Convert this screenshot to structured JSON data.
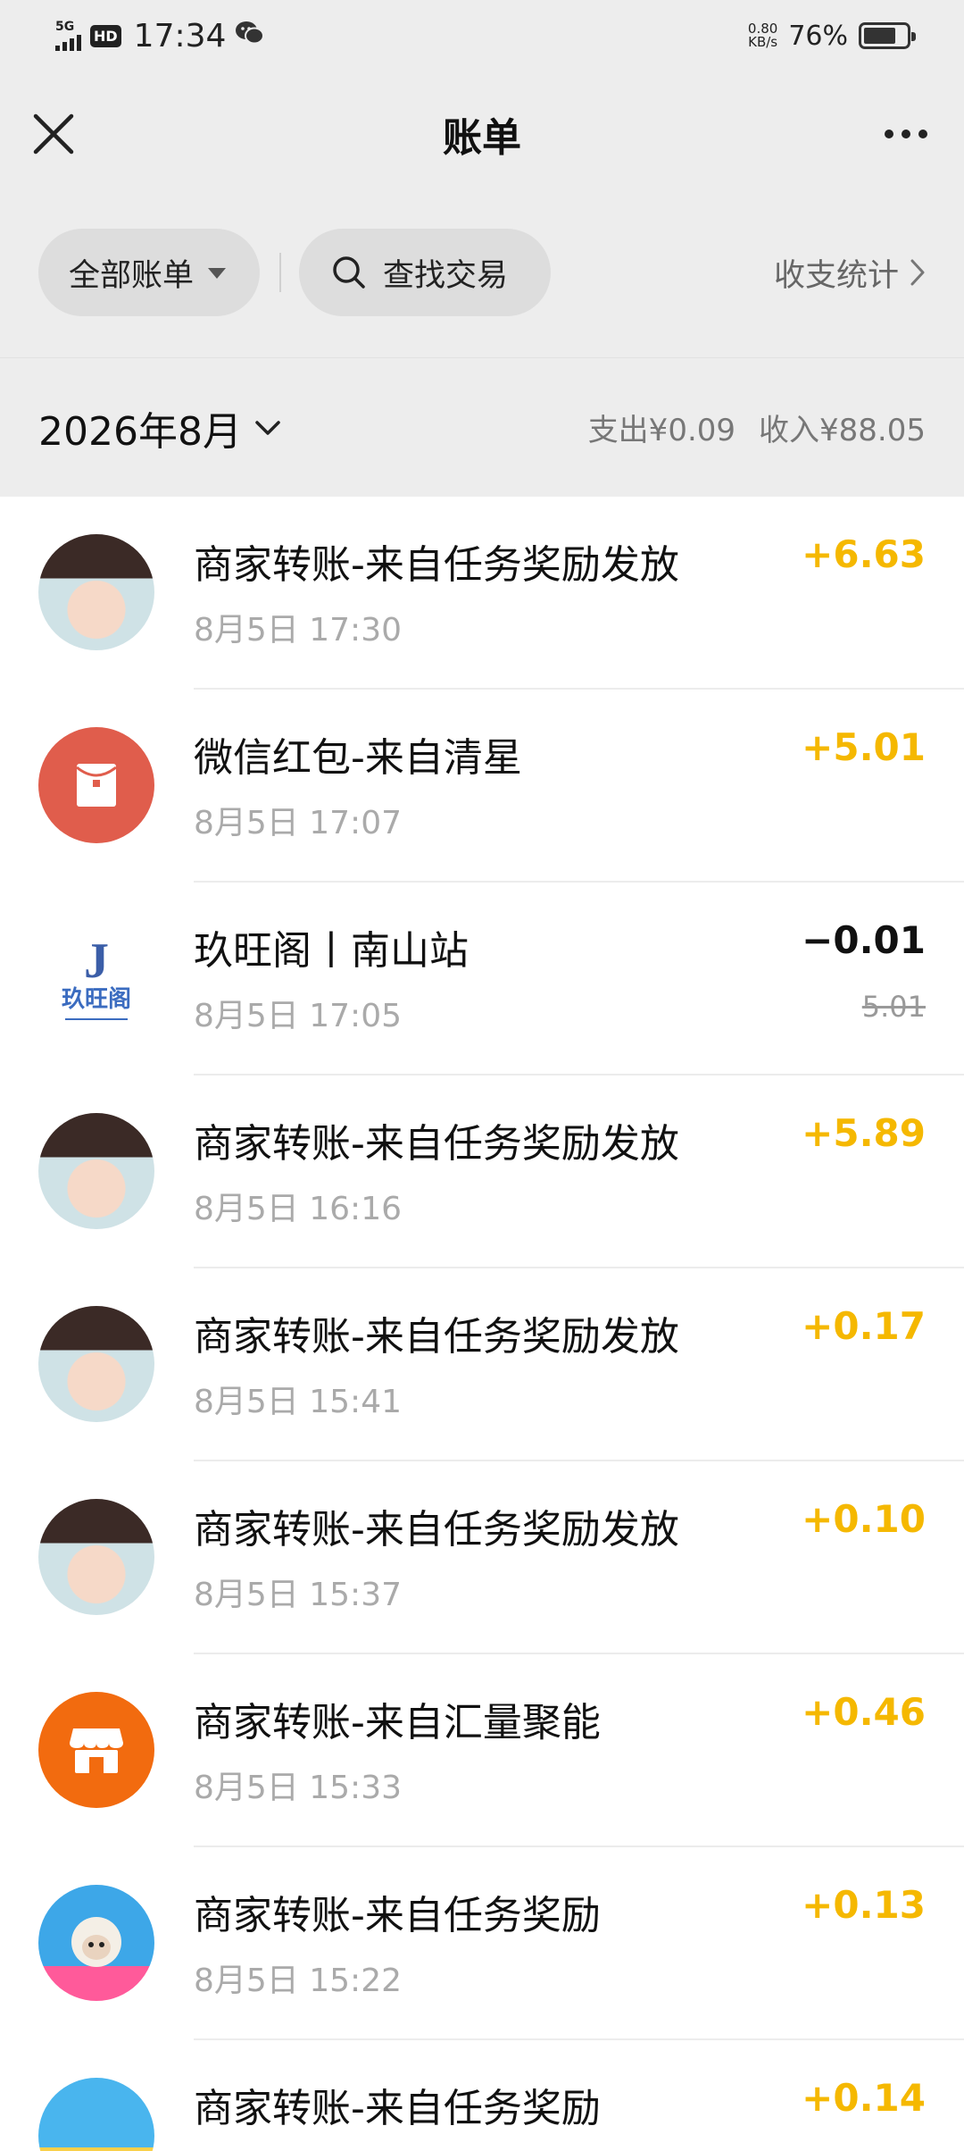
{
  "status_bar": {
    "network": "5G",
    "hd": "HD",
    "time": "17:34",
    "speed_value": "0.80",
    "speed_unit": "KB/s",
    "battery_percent": "76%",
    "battery_level": 0.76
  },
  "nav": {
    "title": "账单"
  },
  "filters": {
    "all_label": "全部账单",
    "search_label": "查找交易",
    "stats_label": "收支统计"
  },
  "month": {
    "label": "2026年8月",
    "expense": "支出¥0.09",
    "income": "收入¥88.05"
  },
  "transactions": [
    {
      "title": "商家转账-来自任务奖励发放",
      "time": "8月5日 17:30",
      "amount": "+6.63",
      "avatar": "lady-avatar"
    },
    {
      "title": "微信红包-来自清星",
      "time": "8月5日 17:07",
      "amount": "+5.01",
      "avatar": "red-packet-icon"
    },
    {
      "title": "玖旺阁丨南山站",
      "time": "8月5日 17:05",
      "amount": "−0.01",
      "original": "5.01",
      "avatar": "jiuwangge-logo",
      "logo_letter": "J",
      "logo_name": "玖旺阁"
    },
    {
      "title": "商家转账-来自任务奖励发放",
      "time": "8月5日 16:16",
      "amount": "+5.89",
      "avatar": "lady-avatar"
    },
    {
      "title": "商家转账-来自任务奖励发放",
      "time": "8月5日 15:41",
      "amount": "+0.17",
      "avatar": "lady-avatar"
    },
    {
      "title": "商家转账-来自任务奖励发放",
      "time": "8月5日 15:37",
      "amount": "+0.10",
      "avatar": "lady-avatar"
    },
    {
      "title": "商家转账-来自汇量聚能",
      "time": "8月5日 15:33",
      "amount": "+0.46",
      "avatar": "shop-icon"
    },
    {
      "title": "商家转账-来自任务奖励",
      "time": "8月5日 15:22",
      "amount": "+0.13",
      "avatar": "sheep-avatar"
    },
    {
      "title": "商家转账-来自任务奖励",
      "time": "",
      "amount": "+0.14",
      "avatar": "yarn-avatar"
    }
  ],
  "colors": {
    "income": "#f5b800",
    "expense": "#111111",
    "red_packet": "#e05d4c",
    "shop": "#f26b0f"
  }
}
